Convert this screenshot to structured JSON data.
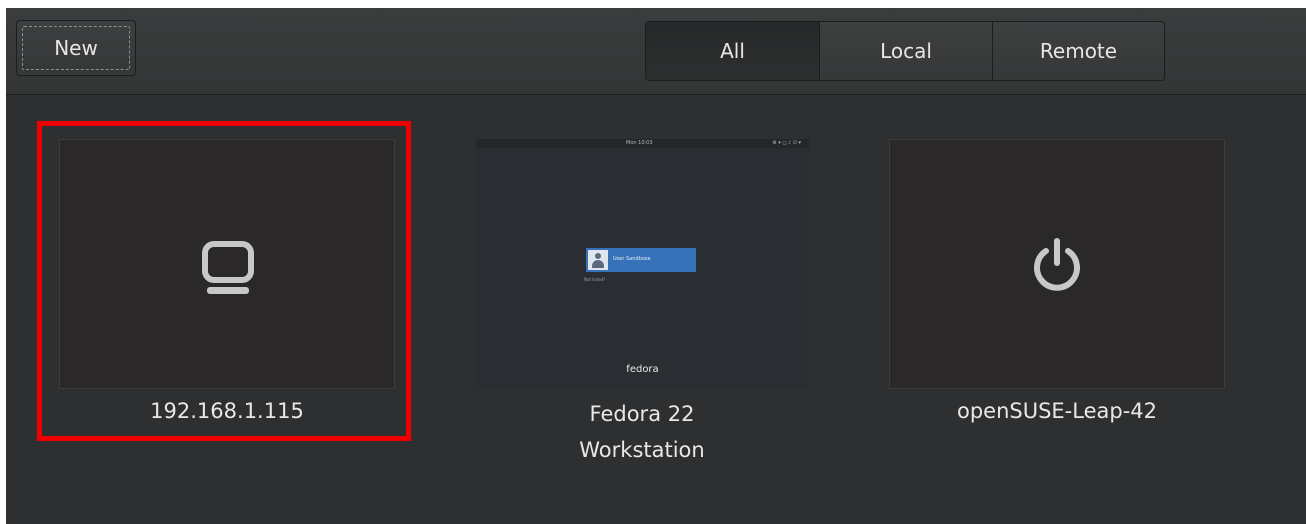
{
  "header": {
    "new_label": "New",
    "filters": [
      {
        "label": "All",
        "active": true
      },
      {
        "label": "Local",
        "active": false
      },
      {
        "label": "Remote",
        "active": false
      }
    ]
  },
  "machines": [
    {
      "label": "192.168.1.115",
      "icon": "monitor-icon",
      "selected": true
    },
    {
      "label_line1": "Fedora 22",
      "label_line2": "Workstation",
      "icon": "screenshot-thumbnail"
    },
    {
      "label": "openSUSE-Leap-42",
      "icon": "power-icon"
    }
  ],
  "fedora_thumbnail": {
    "clock": "Mon 10:03",
    "tray": "⚙ ▾  ◻ ♪ ⏻ ▾",
    "user_name": "User Sandboxe",
    "not_listed": "Not listed?",
    "logo": "fedora"
  },
  "colors": {
    "selection": "#ee0000",
    "background": "#2d2f30",
    "icon_gray": "#c8c8c8"
  }
}
